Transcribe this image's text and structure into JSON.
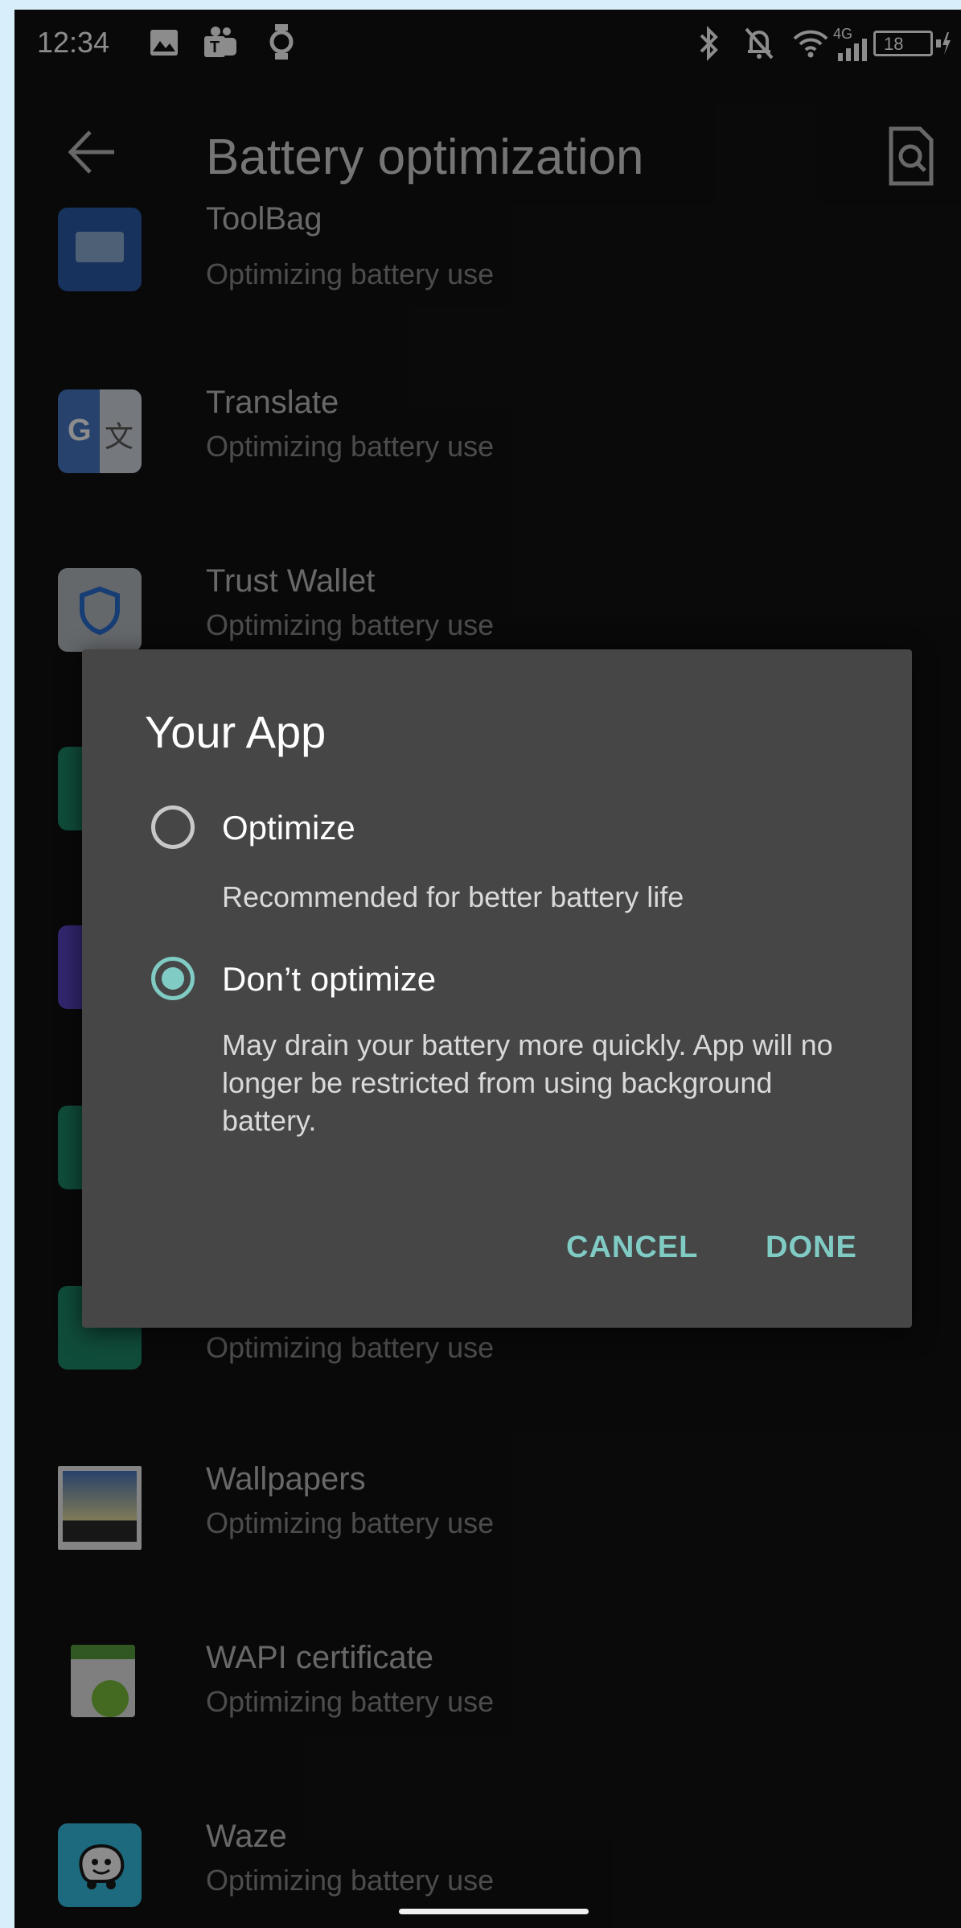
{
  "status_bar": {
    "time": "12:34",
    "network": "4G",
    "battery": "18",
    "icons": [
      "gallery-icon",
      "teams-icon",
      "watch-icon",
      "bluetooth-icon",
      "mute-icon",
      "wifi-icon",
      "signal-icon",
      "battery-icon",
      "charging-icon"
    ]
  },
  "app_bar": {
    "title": "Battery optimization",
    "icons": [
      "back-arrow-icon",
      "search-settings-icon"
    ]
  },
  "apps": [
    {
      "name": "ToolBag",
      "status": "Optimizing battery use",
      "icon": "toolbag-icon"
    },
    {
      "name": "Translate",
      "status": "Optimizing battery use",
      "icon": "translate-icon"
    },
    {
      "name": "Trust Wallet",
      "status": "Optimizing battery use",
      "icon": "shield-icon"
    },
    {
      "name": "",
      "status": "Optimizing battery use",
      "icon": "grid-app-icon"
    },
    {
      "name": "Wallpapers",
      "status": "Optimizing battery use",
      "icon": "wallpaper-icon"
    },
    {
      "name": "WAPI certificate",
      "status": "Optimizing battery use",
      "icon": "certificate-icon"
    },
    {
      "name": "Waze",
      "status": "Optimizing battery use",
      "icon": "waze-icon"
    }
  ],
  "dialog": {
    "title": "Your App",
    "options": [
      {
        "label": "Optimize",
        "description": "Recommended for better battery life",
        "selected": false
      },
      {
        "label": "Don’t optimize",
        "description": "May drain your battery more quickly. App will no longer be restricted from using background battery.",
        "selected": true
      }
    ],
    "cancel_label": "CANCEL",
    "done_label": "DONE"
  },
  "colors": {
    "accent": "#80cbc4",
    "background": "#121212",
    "dialog": "#464646"
  }
}
